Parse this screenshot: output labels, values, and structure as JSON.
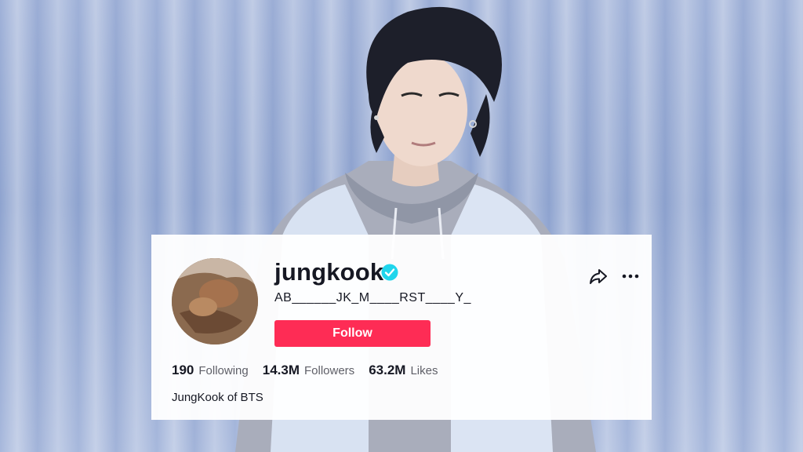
{
  "profile": {
    "username": "jungkook",
    "nickname": "AB______JK_M____RST____Y_",
    "follow_label": "Follow",
    "bio": "JungKook of BTS",
    "verified": true
  },
  "stats": [
    {
      "value": "190",
      "label": "Following"
    },
    {
      "value": "14.3M",
      "label": "Followers"
    },
    {
      "value": "63.2M",
      "label": "Likes"
    }
  ],
  "icons": {
    "verified": "verified-check-icon",
    "share": "share-arrow-icon",
    "more": "more-dots-icon"
  },
  "colors": {
    "follow_button": "#fe2c55",
    "verified_badge": "#20d5ec",
    "text_primary": "#161823",
    "text_secondary": "#5f6068"
  }
}
